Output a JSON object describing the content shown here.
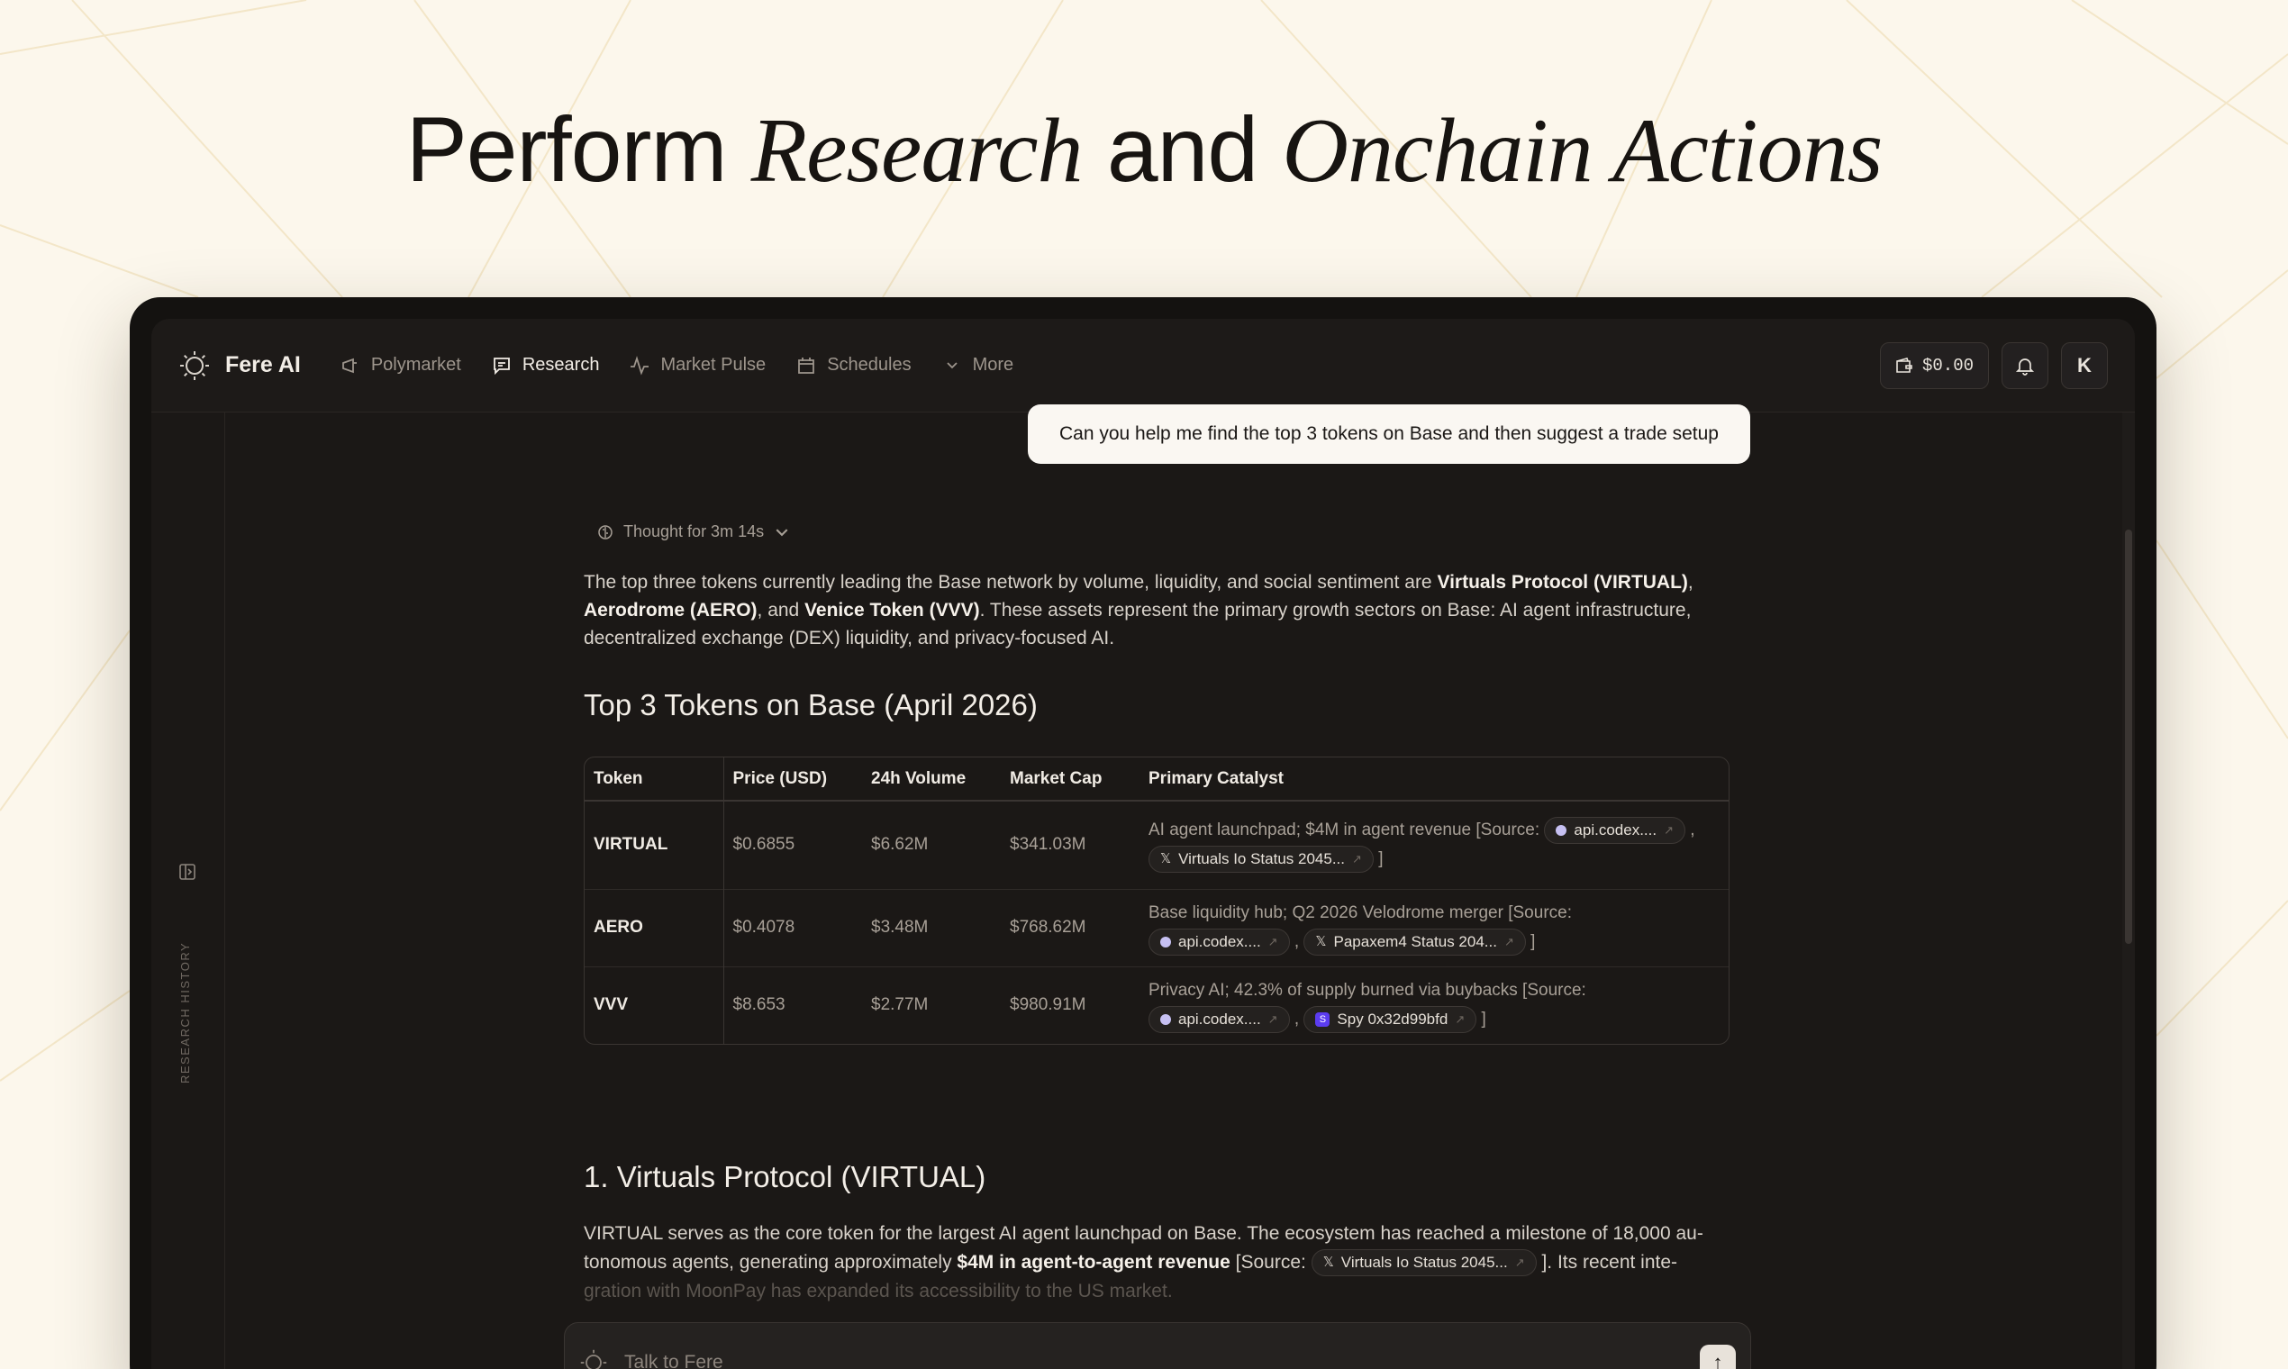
{
  "headline": {
    "part1": "Perform",
    "part2": "Research",
    "part3": "and",
    "part4": "Onchain Actions"
  },
  "app": {
    "name": "Fere AI",
    "nav": [
      {
        "label": "Polymarket",
        "icon": "megaphone-icon"
      },
      {
        "label": "Research",
        "icon": "chat-icon"
      },
      {
        "label": "Market Pulse",
        "icon": "pulse-icon"
      },
      {
        "label": "Schedules",
        "icon": "calendar-icon"
      },
      {
        "label": "More",
        "icon": "chevron-down-icon"
      }
    ],
    "wallet_balance": "$0.00",
    "avatar_initial": "K",
    "sidebar_label": "RESEARCH HISTORY"
  },
  "chat": {
    "user_message": "Can you help me find the top 3 tokens on Base and then suggest a trade setup",
    "thought_label": "Thought for 3m 14s",
    "intro": {
      "t1": "The top three tokens currently leading the Base network by volume, liquidity, and social sentiment are ",
      "b1": "Virtuals Protocol (VIRTUAL)",
      "t2": ", ",
      "b2": "Aerodrome (AERO)",
      "t3": ", and ",
      "b3": "Venice Token (VVV)",
      "t4": ". These assets represent the primary growth sectors on Base: AI agent infrastructure, decentralized exchange (DEX) liquidity, and privacy-focused AI."
    },
    "table_title": "Top 3 Tokens on Base (April 2026)",
    "table": {
      "headers": [
        "Token",
        "Price (USD)",
        "24h Volume",
        "Market Cap",
        "Primary Catalyst"
      ],
      "rows": [
        {
          "token": "VIRTUAL",
          "price": "$0.6855",
          "volume": "$6.62M",
          "mcap": "$341.03M",
          "catalyst": "AI agent launchpad; $4M in agent revenue [Source:",
          "chip1": "api.codex....",
          "chip2": "Virtuals Io Status 2045...",
          "close": "]"
        },
        {
          "token": "AERO",
          "price": "$0.4078",
          "volume": "$3.48M",
          "mcap": "$768.62M",
          "catalyst": "Base liquidity hub; Q2 2026 Velodrome merger [Source:",
          "chip1": "api.codex....",
          "chip2": "Papaxem4 Status 204...",
          "close": "]"
        },
        {
          "token": "VVV",
          "price": "$8.653",
          "volume": "$2.77M",
          "mcap": "$980.91M",
          "catalyst": "Privacy AI; 42.3% of supply burned via buybacks [Source:",
          "chip1": "api.codex....",
          "chip2": "Spy 0x32d99bfd",
          "close": "]"
        }
      ]
    },
    "section1_title": "1. Virtuals Protocol (VIRTUAL)",
    "section1": {
      "t1": "VIRTUAL serves as the core token for the largest AI agent launchpad on Base. The ecosystem has reached a milestone of 18,000 au-tonomous agents, generating approximately ",
      "b1": "$4M in agent-to-agent revenue",
      "t2": " [Source: ",
      "chip": "Virtuals Io Status 2045...",
      "t3": " ]. Its recent inte-",
      "t4": "gration with MoonPay has expanded its accessibility to the US market."
    },
    "composer_placeholder": "Talk to Fere"
  }
}
